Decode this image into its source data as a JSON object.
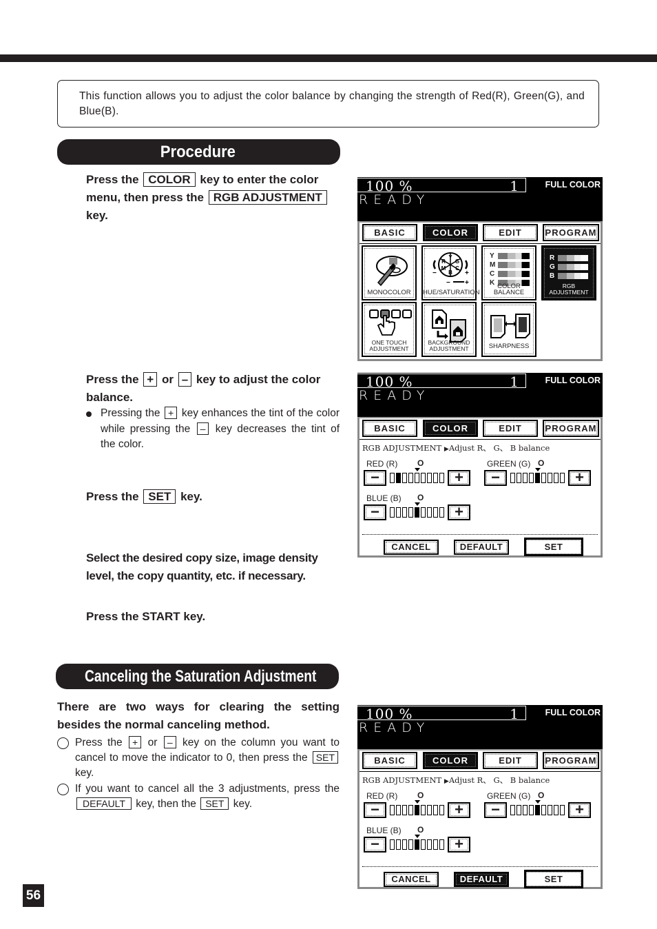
{
  "page": {
    "number": "56"
  },
  "intro": {
    "text": "This function allows you to adjust the color balance by changing the strength of Red(R), Green(G), and Blue(B)."
  },
  "procedure": {
    "heading": "Procedure",
    "steps": [
      {
        "parts": [
          "Press the",
          "COLOR",
          "key to enter the color menu, then press the",
          "RGB ADJUSTMENT",
          "key."
        ]
      },
      {
        "parts": [
          "Press the",
          "+",
          "or",
          "–",
          "key to adjust the color balance."
        ],
        "note": {
          "parts": [
            "Pressing the",
            "+",
            "key enhances the tint of the color while pressing the",
            "–",
            "key decreases the tint of the color."
          ]
        }
      },
      {
        "parts": [
          "Press the",
          "SET",
          "key."
        ]
      },
      {
        "text": "Select the desired copy size, image density level, the copy quantity, etc. if necessary."
      },
      {
        "text": "Press the START key."
      }
    ]
  },
  "canceling": {
    "heading": "Canceling the Saturation Adjustment",
    "intro": "There are two ways for clearing the setting besides the normal canceling method.",
    "items": [
      {
        "parts": [
          "Press the",
          "+",
          "or",
          "–",
          "key on the column you want to cancel to move the indicator to 0, then press the",
          "SET",
          "key."
        ]
      },
      {
        "parts": [
          "If you want to cancel all the 3 adjustments, press the",
          "DEFAULT",
          "key, then the",
          "SET",
          "key."
        ]
      }
    ]
  },
  "panel_common": {
    "zoom": "100 %",
    "count": "1",
    "mode": "FULL COLOR",
    "status": "READY",
    "tabs": [
      "BASIC",
      "COLOR",
      "EDIT",
      "PROGRAM"
    ],
    "active_tab": "COLOR"
  },
  "panel_color_menu": {
    "tiles": [
      {
        "label": "MONOCOLOR",
        "icon": "palette-brush-icon",
        "selected": false
      },
      {
        "label": "HUE/SATURATION",
        "icon": "color-wheel-icon",
        "selected": false,
        "wheel_letters": [
          "Y",
          "G",
          "C",
          "B",
          "M",
          "R"
        ]
      },
      {
        "label": "COLOR BALANCE",
        "icon": "ymck-bars-icon",
        "selected": false,
        "bars": [
          "Y",
          "M",
          "C",
          "K"
        ]
      },
      {
        "label1": "RGB",
        "label2": "ADJUSTMENT",
        "icon": "rgb-bars-icon",
        "selected": true,
        "bars": [
          "R",
          "G",
          "B"
        ]
      },
      {
        "label1": "ONE TOUCH",
        "label2": "ADJUSTMENT",
        "icon": "one-touch-hand-icon",
        "selected": false
      },
      {
        "label1": "BACKGROUND",
        "label2": "ADJUSTMENT",
        "icon": "background-house-icon",
        "selected": false
      },
      {
        "label": "SHARPNESS",
        "icon": "sharpness-pages-icon",
        "selected": false
      }
    ]
  },
  "rgb_screen": {
    "title": "RGB ADJUSTMENT",
    "subtitle": "Adjust R、 G、 B balance",
    "zero_label": "O",
    "minus": "−",
    "plus": "+",
    "segments": 9,
    "buttons": {
      "cancel": "CANCEL",
      "default": "DEFAULT",
      "set": "SET"
    }
  },
  "panel_adjust": {
    "channels": [
      {
        "label": "RED (R)",
        "level": -3
      },
      {
        "label": "GREEN (G)",
        "level": 0
      },
      {
        "label": "BLUE (B)",
        "level": 0
      }
    ],
    "default_highlighted": false
  },
  "panel_default": {
    "channels": [
      {
        "label": "RED (R)",
        "level": 0
      },
      {
        "label": "GREEN (G)",
        "level": 0
      },
      {
        "label": "BLUE (B)",
        "level": 0
      }
    ],
    "default_highlighted": true
  }
}
